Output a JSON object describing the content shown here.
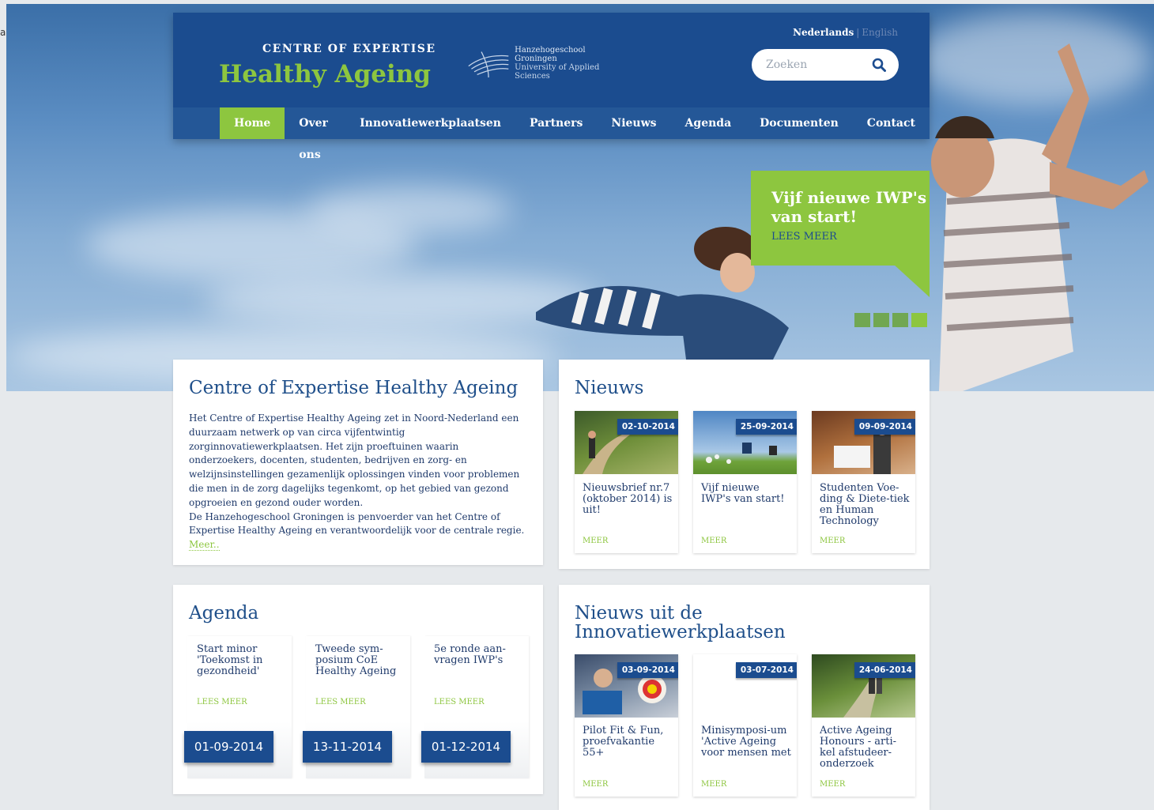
{
  "corner_text": "a",
  "header": {
    "logo_top": "CENTRE OF EXPERTISE",
    "logo_main": "Healthy Ageing",
    "partner_name": "Hanzehogeschool",
    "partner_city": "Groningen",
    "partner_sub": "University of Applied Sciences",
    "lang_active": "Nederlands",
    "lang_sep": "|",
    "lang_other": "English",
    "search_placeholder": "Zoeken"
  },
  "nav": [
    {
      "label": "Home",
      "active": true
    },
    {
      "label": "Over ons"
    },
    {
      "label": "Innovatiewerkplaatsen"
    },
    {
      "label": "Partners"
    },
    {
      "label": "Nieuws"
    },
    {
      "label": "Agenda"
    },
    {
      "label": "Documenten"
    },
    {
      "label": "Contact"
    }
  ],
  "promo": {
    "title": "Vijf nieuwe IWP's van start!",
    "more": "LEES MEER",
    "slides": 4,
    "active_slide": 4
  },
  "intro": {
    "title": "Centre of Expertise Healthy Ageing",
    "body": "Het Centre of Expertise Healthy Ageing zet in Noord-Nederland een duurzaam netwerk op van circa vijfentwintig zorginnovatiewerkplaatsen. Het zijn proeftuinen waarin onderzoekers, docenten, studenten, bedrijven en zorg- en welzijnsinstellingen gezamenlijk oplossingen vinden voor problemen die men in de zorg dagelijks tegenkomt, op het gebied van gezond opgroeien en gezond ouder worden.",
    "body2": "De Hanzehogeschool Groningen is penvoerder van het Centre of Expertise Healthy Ageing en verantwoordelijk voor de centrale regie.",
    "more": "Meer.."
  },
  "news": {
    "title": "Nieuws",
    "items": [
      {
        "date": "02-10-2014",
        "title": "Nieuwsbrief nr.7 (oktober 2014) is uit!",
        "more": "MEER"
      },
      {
        "date": "25-09-2014",
        "title": "Vijf nieuwe IWP's van start!",
        "more": "MEER"
      },
      {
        "date": "09-09-2014",
        "title": "Studenten Voe-ding & Diete-tiek en Human Technology",
        "more": "MEER"
      }
    ]
  },
  "agenda": {
    "title": "Agenda",
    "items": [
      {
        "title": "Start minor 'Toekomst in gezondheid'",
        "more": "LEES MEER",
        "date": "01-09-2014"
      },
      {
        "title": "Tweede sym-posium CoE Healthy Ageing",
        "more": "LEES MEER",
        "date": "13-11-2014"
      },
      {
        "title": "5e ronde aan-vragen IWP's",
        "more": "LEES MEER",
        "date": "01-12-2014"
      }
    ]
  },
  "iwp": {
    "title_line1": "Nieuws uit de",
    "title_line2": "Innovatiewerkplaatsen",
    "items": [
      {
        "date": "03-09-2014",
        "title": "Pilot Fit & Fun, proefvakantie 55+",
        "more": "MEER"
      },
      {
        "date": "03-07-2014",
        "title": "Minisymposi-um 'Active Ageing voor mensen met",
        "more": "MEER"
      },
      {
        "date": "24-06-2014",
        "title": "Active Ageing Honours - arti-kel afstudeer-onderzoek",
        "more": "MEER"
      }
    ]
  },
  "colors": {
    "brand_blue": "#1b4c8f",
    "brand_green": "#8dc63f"
  }
}
